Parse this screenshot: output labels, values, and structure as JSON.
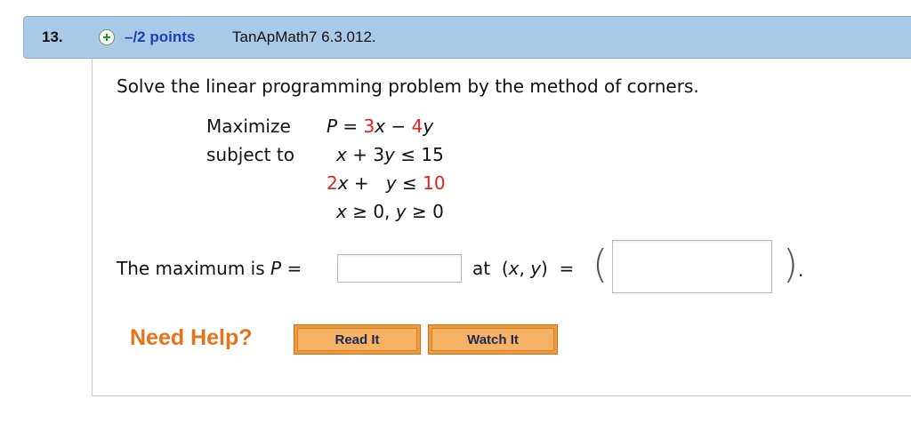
{
  "header": {
    "question_number": "13.",
    "points": "–/2 points",
    "source": "TanApMath7 6.3.012."
  },
  "problem": {
    "prompt": "Solve the linear programming problem by the method of corners.",
    "maximize_label": "Maximize",
    "subject_to_label": "subject to",
    "objective": {
      "lhs": "P",
      "eq": " = ",
      "c1": "3",
      "v1": "x",
      "op": " − ",
      "c2": "4",
      "v2": "y"
    },
    "constraint1": {
      "v1": "x",
      "mid": " + 3",
      "v2": "y",
      "rhs": " ≤ 15"
    },
    "constraint2": {
      "c1": "2",
      "v1": "x",
      "mid": " +   ",
      "v2": "y",
      "rel": " ≤ ",
      "rhs": "10"
    },
    "nonneg": {
      "v1": "x",
      "a": " ≥ 0, ",
      "v2": "y",
      "b": " ≥ 0"
    }
  },
  "answer": {
    "label_start": "The maximum is ",
    "label_var": "P",
    "label_end": " =",
    "at_label": "at  (",
    "at_x": "x",
    "at_comma": ", ",
    "at_y": "y",
    "at_end": ")  =",
    "max_value": "",
    "point_value": "",
    "open_paren": "(",
    "close_paren": ")",
    "period": "."
  },
  "help": {
    "label": "Need Help?",
    "read_it": "Read It",
    "watch_it": "Watch It"
  },
  "colors": {
    "header_bg": "#a9c9e6",
    "points_blue": "#1a3fb8",
    "coef_red": "#e0231b",
    "help_orange": "#e8721a",
    "button_orange": "#f29a3b"
  }
}
